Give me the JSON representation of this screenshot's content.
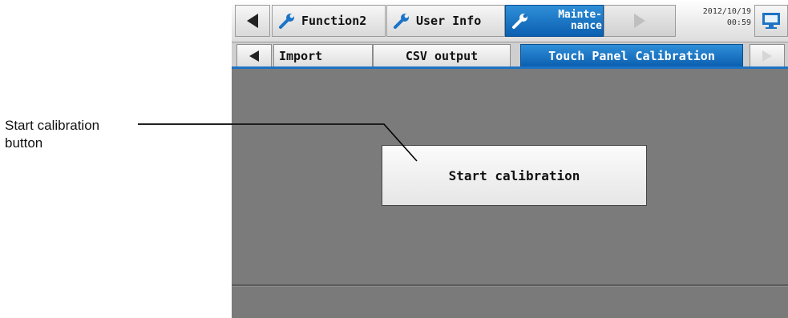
{
  "callout": {
    "line1": "Start calibration",
    "line2": "button"
  },
  "topbar": {
    "tabs": [
      {
        "label": "Function2",
        "icon": "wrench-icon"
      },
      {
        "label": "User Info",
        "icon": "wrench-icon"
      },
      {
        "label_line1": "Mainte-",
        "label_line2": "nance",
        "icon": "wrench-icon",
        "active": true
      }
    ],
    "date": "2012/10/19",
    "time": "00:59",
    "accent": "#1e73c4"
  },
  "subtabs": [
    {
      "label": "Import"
    },
    {
      "label": "CSV output"
    },
    {
      "label": "Touch Panel Calibration",
      "active": true
    }
  ],
  "main": {
    "start_button_label": "Start calibration"
  }
}
